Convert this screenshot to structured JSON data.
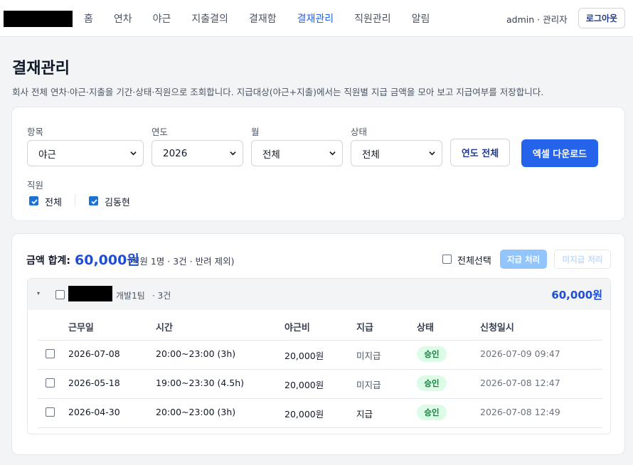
{
  "nav": {
    "items": [
      {
        "label": "홈",
        "active": false
      },
      {
        "label": "연차",
        "active": false
      },
      {
        "label": "야근",
        "active": false
      },
      {
        "label": "지출결의",
        "active": false
      },
      {
        "label": "결재함",
        "active": false
      },
      {
        "label": "결재관리",
        "active": true
      },
      {
        "label": "직원관리",
        "active": false
      },
      {
        "label": "알림",
        "active": false
      }
    ],
    "user": "admin · 관리자",
    "logout_label": "로그아웃"
  },
  "page": {
    "title": "결재관리",
    "description": "회사 전체 연차·야근·지출을 기간·상태·직원으로 조회합니다. 지급대상(야근+지출)에서는 직원별 지급 금액을 모아 보고 지급여부를 저장합니다."
  },
  "filters": {
    "category": {
      "label": "항목",
      "value": "야근"
    },
    "year": {
      "label": "연도",
      "value": "2026"
    },
    "month": {
      "label": "월",
      "value": "전체"
    },
    "status": {
      "label": "상태",
      "value": "전체"
    },
    "year_all_button": "연도 전체",
    "excel_button": "엑셀 다운로드",
    "employee_label": "직원",
    "employee_options": [
      {
        "label": "전체",
        "checked": true
      },
      {
        "label": "김동현",
        "checked": true
      }
    ]
  },
  "summary": {
    "label": "금액 합계:",
    "total": "60,000원",
    "note": "(직원 1명 · 3건 · 반려 제외)",
    "select_all_label": "전체선택",
    "pay_button": "지급 처리",
    "unpay_button": "미지급 처리"
  },
  "group": {
    "team": "개발1팀",
    "count": "· 3건",
    "total": "60,000원",
    "toggle_icon": "▾",
    "columns": [
      "근무일",
      "시간",
      "야근비",
      "지급",
      "상태",
      "신청일시"
    ],
    "rows": [
      {
        "date": "2026-07-08",
        "time": "20:00~23:00 (3h)",
        "amount": "20,000원",
        "paid": "미지급",
        "status": "승인",
        "requested": "2026-07-09 09:47"
      },
      {
        "date": "2026-05-18",
        "time": "19:00~23:30 (4.5h)",
        "amount": "20,000원",
        "paid": "미지급",
        "status": "승인",
        "requested": "2026-07-08 12:47"
      },
      {
        "date": "2026-04-30",
        "time": "20:00~23:00 (3h)",
        "amount": "20,000원",
        "paid": "지급",
        "status": "승인",
        "requested": "2026-07-08 12:49"
      }
    ]
  },
  "colors": {
    "accent": "#2563eb",
    "badge_bg": "#dcfce7",
    "badge_text": "#15803d"
  }
}
